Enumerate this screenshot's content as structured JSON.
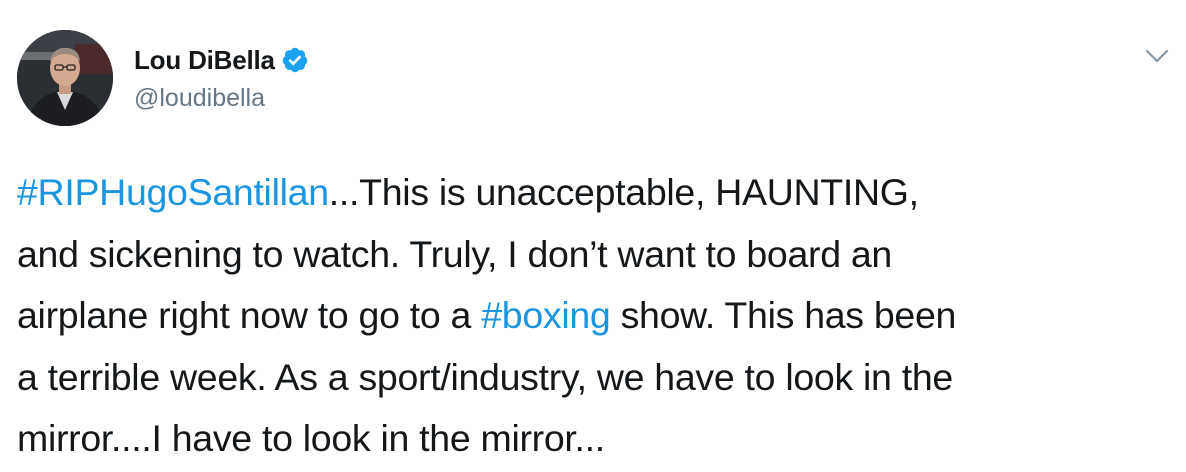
{
  "author": {
    "display_name": "Lou DiBella",
    "handle": "@loudibella",
    "verified": true,
    "verified_color": "#1da1f2"
  },
  "menu": {
    "icon": "chevron-down-icon"
  },
  "tweet": {
    "lines": [
      {
        "hashtag": "#RIPHugoSantillan",
        "text_after": "...This is unacceptable, HAUNTING,"
      },
      {
        "text": "and sickening to watch. Truly, I don’t want to board an"
      },
      {
        "text_before": "airplane right now to go to a ",
        "hashtag": "#boxing",
        "text_after": " show. This has been"
      },
      {
        "text": "a terrible week. As a sport/industry, we have to look in the"
      },
      {
        "text": "mirror....I have to look in the mirror..."
      }
    ]
  },
  "colors": {
    "hashtag": "#1b95e0",
    "handle": "#657786",
    "text": "#14171a"
  }
}
